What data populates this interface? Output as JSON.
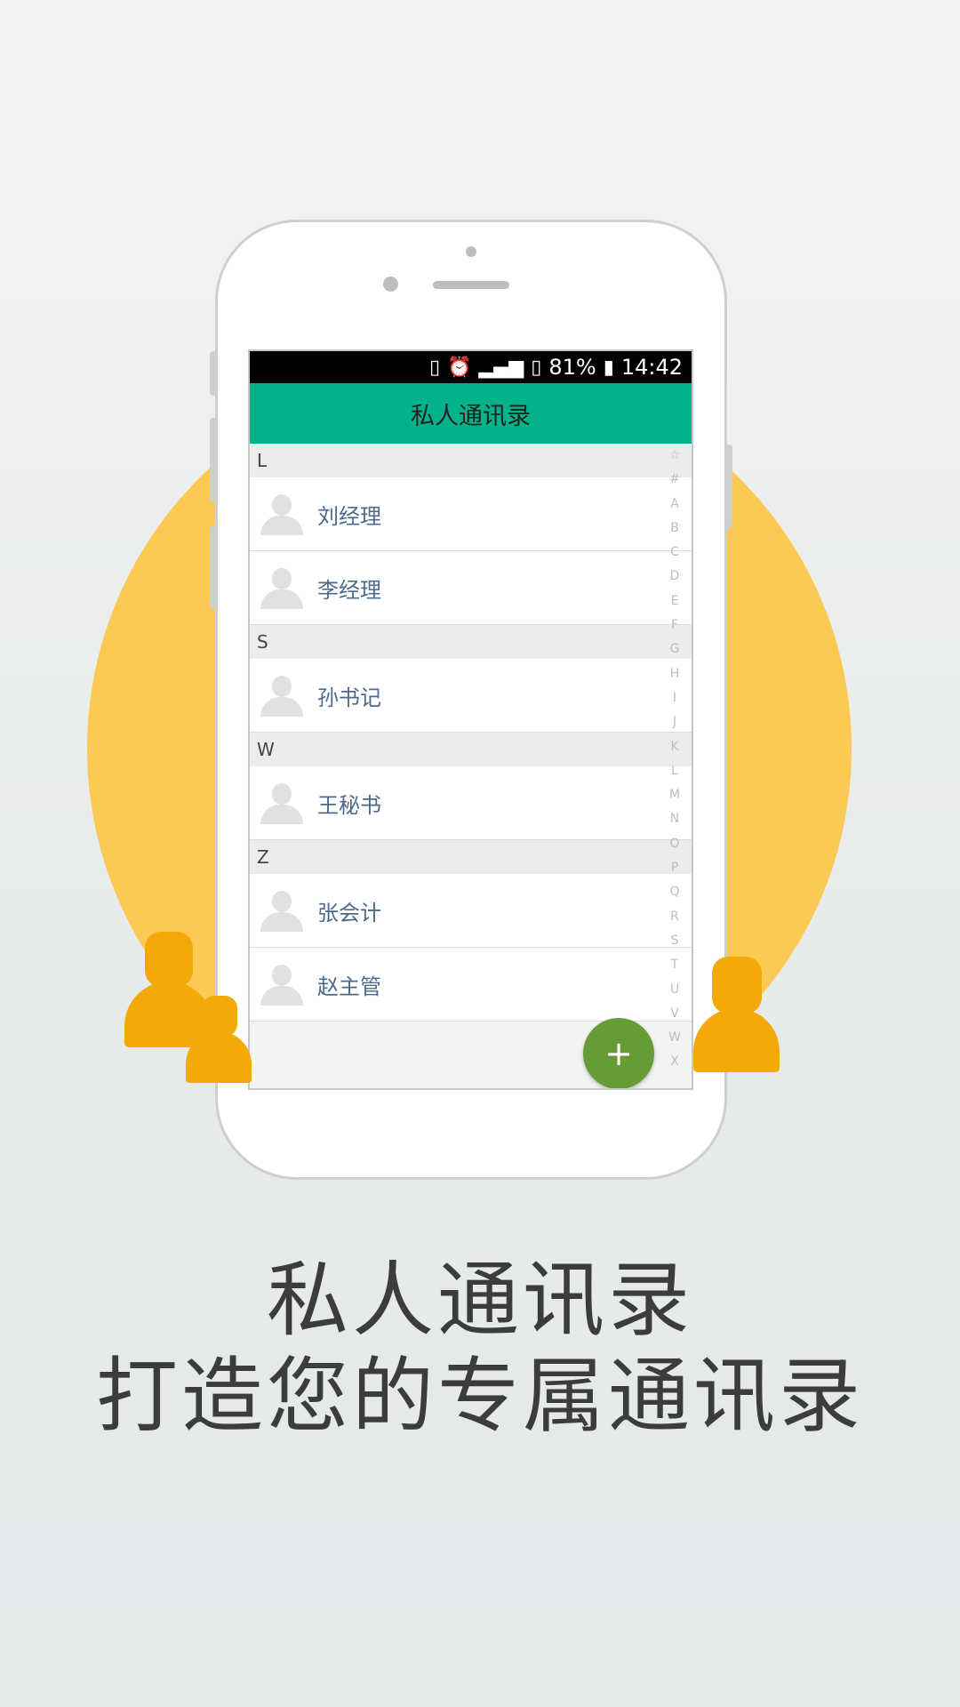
{
  "status_bar": {
    "icons": [
      "vibrate-icon",
      "alarm-icon",
      "signal-3g-1x-icon",
      "sim-icon"
    ],
    "battery": "81%",
    "time": "14:42"
  },
  "app_bar": {
    "title": "私人通讯录"
  },
  "contact_sections": [
    {
      "letter": "L",
      "contacts": [
        {
          "name": "刘经理"
        },
        {
          "name": "李经理"
        }
      ]
    },
    {
      "letter": "S",
      "contacts": [
        {
          "name": "孙书记"
        }
      ]
    },
    {
      "letter": "W",
      "contacts": [
        {
          "name": "王秘书"
        }
      ]
    },
    {
      "letter": "Z",
      "contacts": [
        {
          "name": "张会计"
        },
        {
          "name": "赵主管"
        }
      ]
    }
  ],
  "index_letters": [
    "☆",
    "#",
    "A",
    "B",
    "C",
    "D",
    "E",
    "F",
    "G",
    "H",
    "I",
    "J",
    "K",
    "L",
    "M",
    "N",
    "O",
    "P",
    "Q",
    "R",
    "S",
    "T",
    "U",
    "V",
    "W",
    "X"
  ],
  "fab": {
    "label": "+"
  },
  "caption": {
    "line1": "私人通讯录",
    "line2": "打造您的专属通讯录"
  },
  "colors": {
    "accent": "#00b38a",
    "fab": "#669c35",
    "circle": "#fcc955",
    "person": "#f4aa06",
    "contact_name": "#4d6a8c"
  }
}
